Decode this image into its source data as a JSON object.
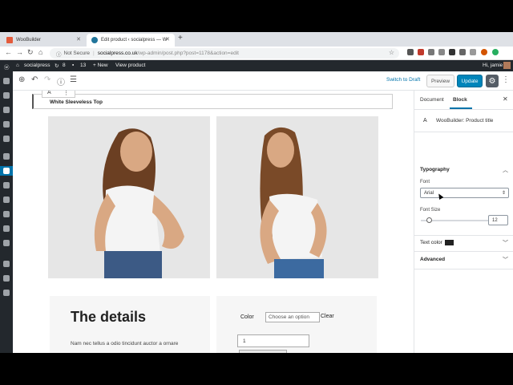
{
  "browser": {
    "tabs": [
      {
        "label": "WooBuilder",
        "favicon_color": "#e45b3c"
      },
      {
        "label": "Edit product ‹ socialpress — W",
        "favicon_color": "#21759b"
      }
    ],
    "new_tab": "+",
    "security": "Not Secure",
    "url_host": "socialpress.co.uk",
    "url_path": "/wp-admin/post.php?post=1178&action=edit"
  },
  "adminbar": {
    "site": "socialpress",
    "updates": "8",
    "comments": "13",
    "new": "+ New",
    "view": "View product",
    "greeting": "Hi, jamie"
  },
  "toolbar": {
    "switch_draft": "Switch to Draft",
    "preview": "Preview",
    "update": "Update"
  },
  "editor": {
    "block_icon": "A",
    "block_more": "⋮",
    "product_title": "White Sleeveless Top"
  },
  "product": {
    "details_heading": "The details",
    "details_text": "Nam nec tellus a odio tincidunt auctor a ornare",
    "color_label": "Color",
    "color_placeholder": "Choose an option",
    "clear": "Clear",
    "quantity": "1"
  },
  "settings": {
    "tab_document": "Document",
    "tab_block": "Block",
    "block_icon": "A",
    "block_name": "WooBuilder: Product title",
    "typography": "Typography",
    "font_label": "Font",
    "font_value": "Arial",
    "font_size_label": "Font Size",
    "font_size_value": "12",
    "font_size_level_pct": 12,
    "text_color_label": "Text color",
    "text_color_value": "#222222",
    "advanced": "Advanced"
  },
  "colors": {
    "accent": "#0073aa",
    "update_button": "#0085ba",
    "admin_bar": "#23282d"
  }
}
